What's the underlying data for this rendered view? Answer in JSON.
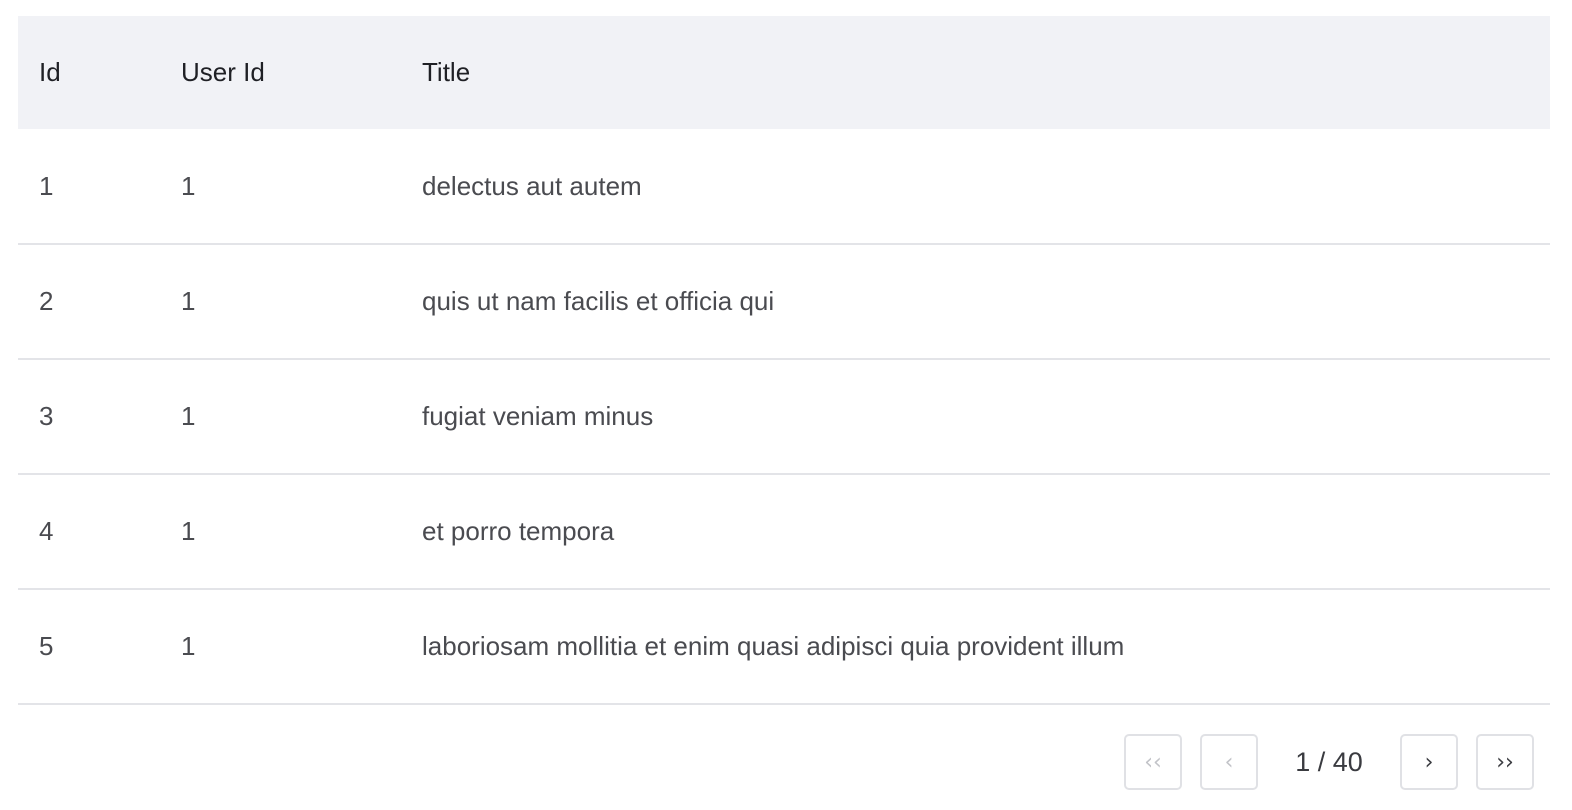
{
  "table": {
    "columns": [
      "Id",
      "User Id",
      "Title"
    ],
    "rows": [
      {
        "id": "1",
        "user_id": "1",
        "title": "delectus aut autem"
      },
      {
        "id": "2",
        "user_id": "1",
        "title": "quis ut nam facilis et officia qui"
      },
      {
        "id": "3",
        "user_id": "1",
        "title": "fugiat veniam minus"
      },
      {
        "id": "4",
        "user_id": "1",
        "title": "et porro tempora"
      },
      {
        "id": "5",
        "user_id": "1",
        "title": "laboriosam mollitia et enim quasi adipisci quia provident illum"
      }
    ]
  },
  "pagination": {
    "first_label": "‹‹",
    "prev_label": "‹",
    "page_indicator": "1 / 40",
    "next_label": "›",
    "last_label": "››",
    "current_page": 1,
    "total_pages": 40
  },
  "colors": {
    "header_bg": "#f1f2f6",
    "row_border": "#e3e4e8",
    "disabled_icon": "#c2c3c8"
  }
}
